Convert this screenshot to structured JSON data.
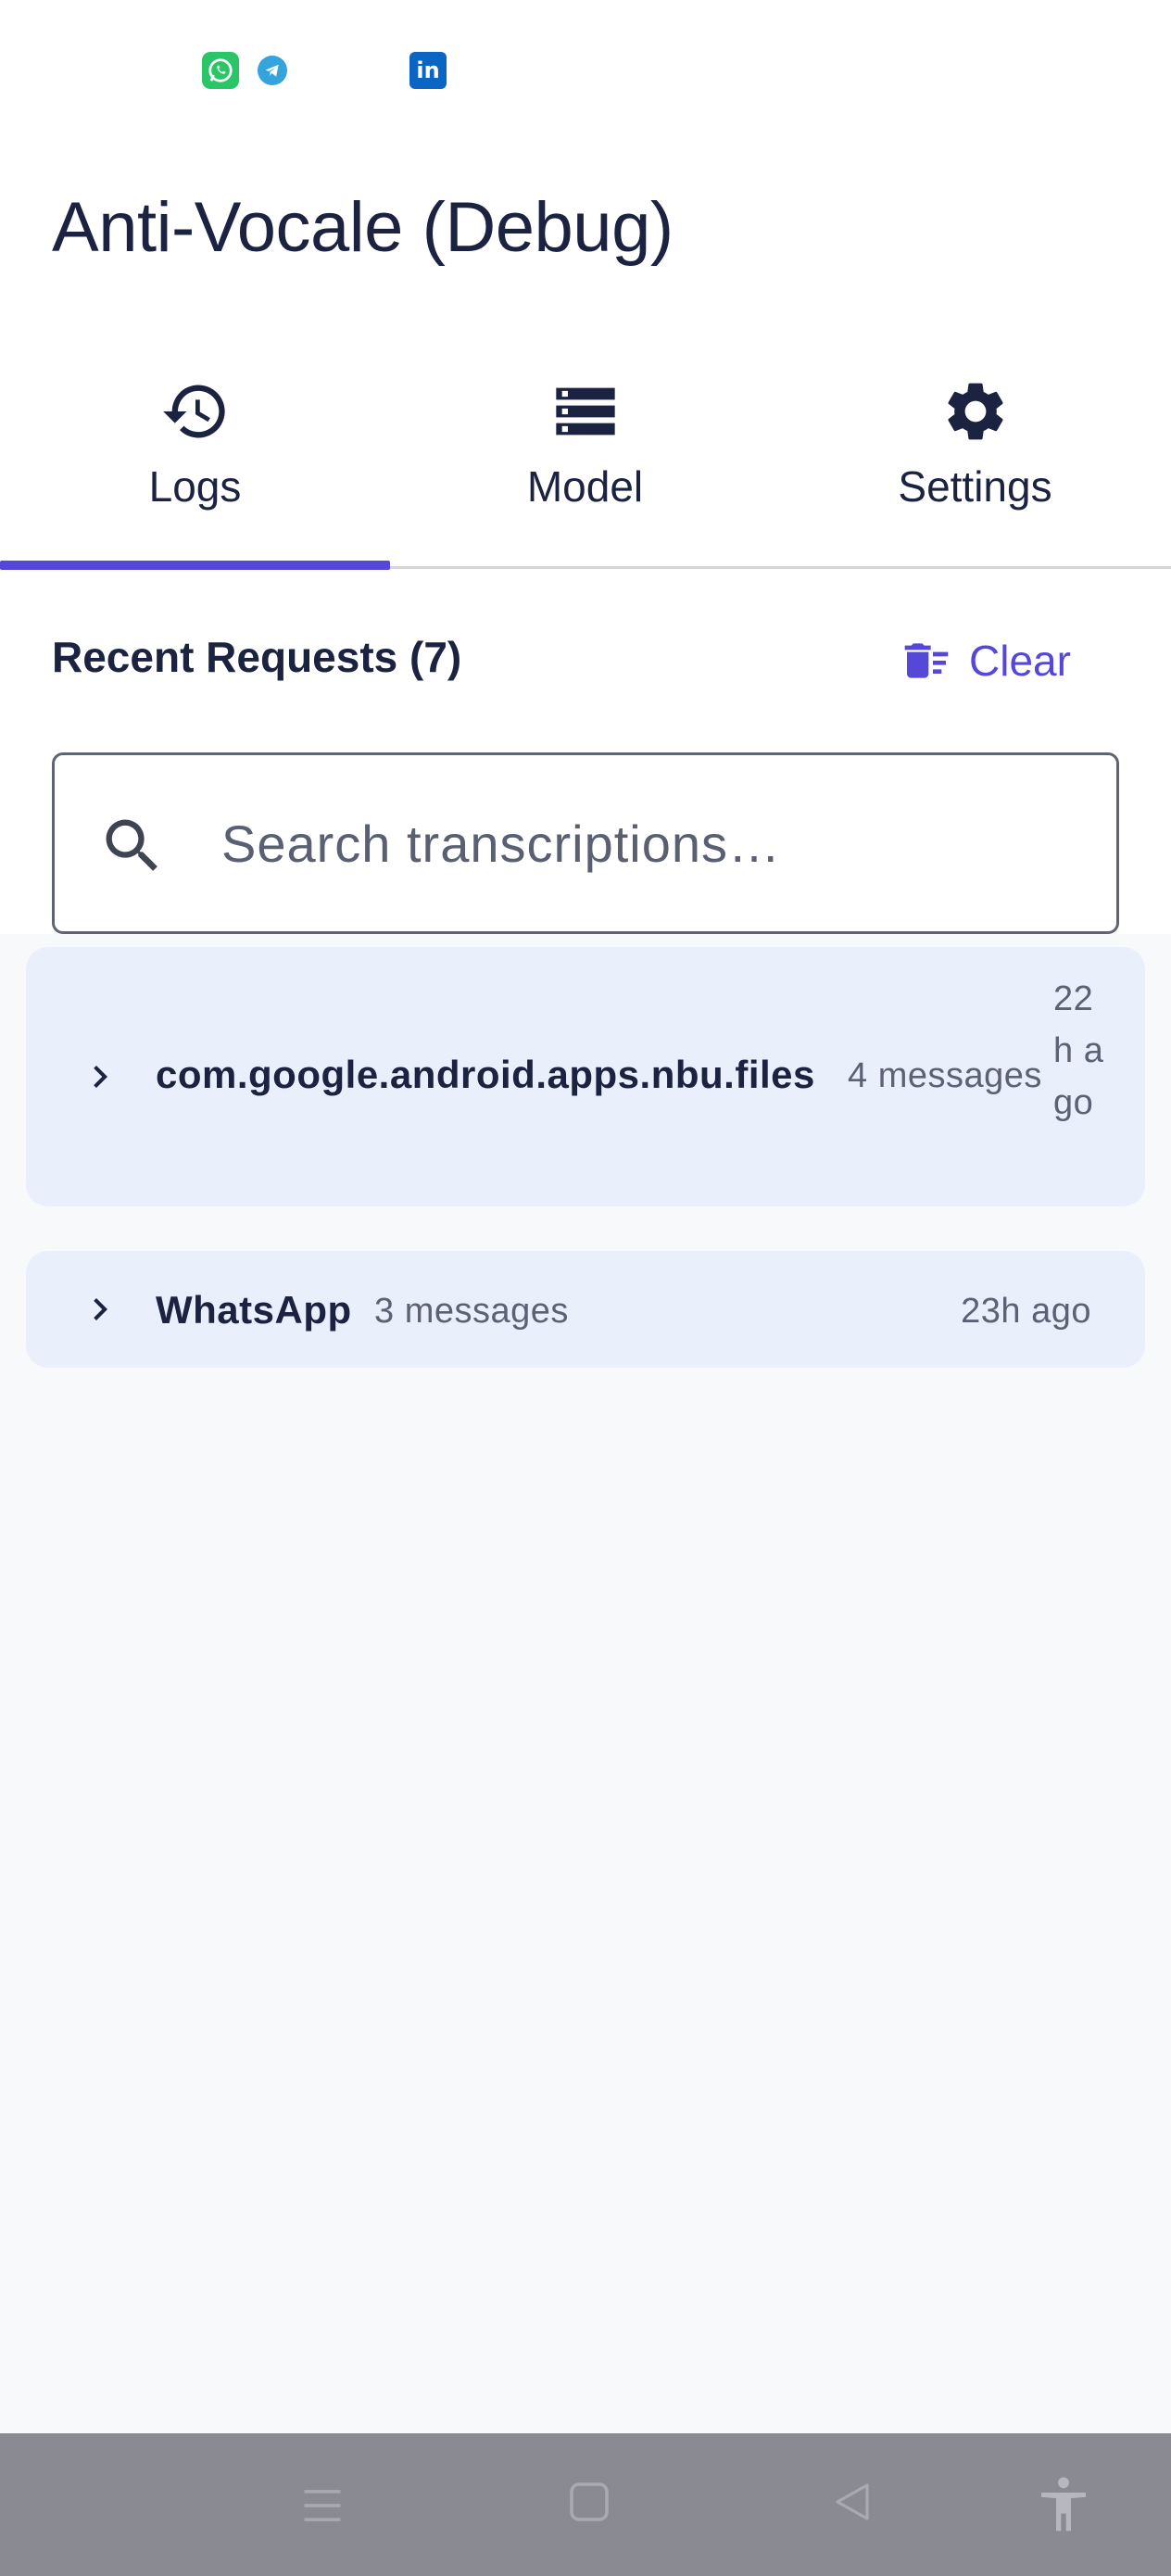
{
  "status_bar": {
    "icons": [
      "whatsapp-icon",
      "telegram-icon",
      "linkedin-icon"
    ],
    "linkedin_glyph": "in"
  },
  "app": {
    "title": "Anti-Vocale (Debug)"
  },
  "tabs": [
    {
      "label": "Logs",
      "icon": "history-icon",
      "selected": true
    },
    {
      "label": "Model",
      "icon": "storage-icon",
      "selected": false
    },
    {
      "label": "Settings",
      "icon": "gear-icon",
      "selected": false
    }
  ],
  "logs": {
    "section_title": "Recent Requests (7)",
    "clear_label": "Clear",
    "search": {
      "placeholder": "Search transcriptions…",
      "value": ""
    },
    "groups": [
      {
        "app": "com.google.android.apps.nbu.files",
        "count": "4 messages",
        "time": "22h ago"
      },
      {
        "app": "WhatsApp",
        "count": "3 messages",
        "time": "23h ago"
      }
    ]
  },
  "colors": {
    "accent": "#5548d9",
    "text": "#1b2340",
    "card_bg": "#eaeffc",
    "nav_bar": "#898a92"
  },
  "nav_bar": {
    "buttons": [
      "menu-icon",
      "home-icon",
      "back-icon",
      "accessibility-icon"
    ]
  }
}
